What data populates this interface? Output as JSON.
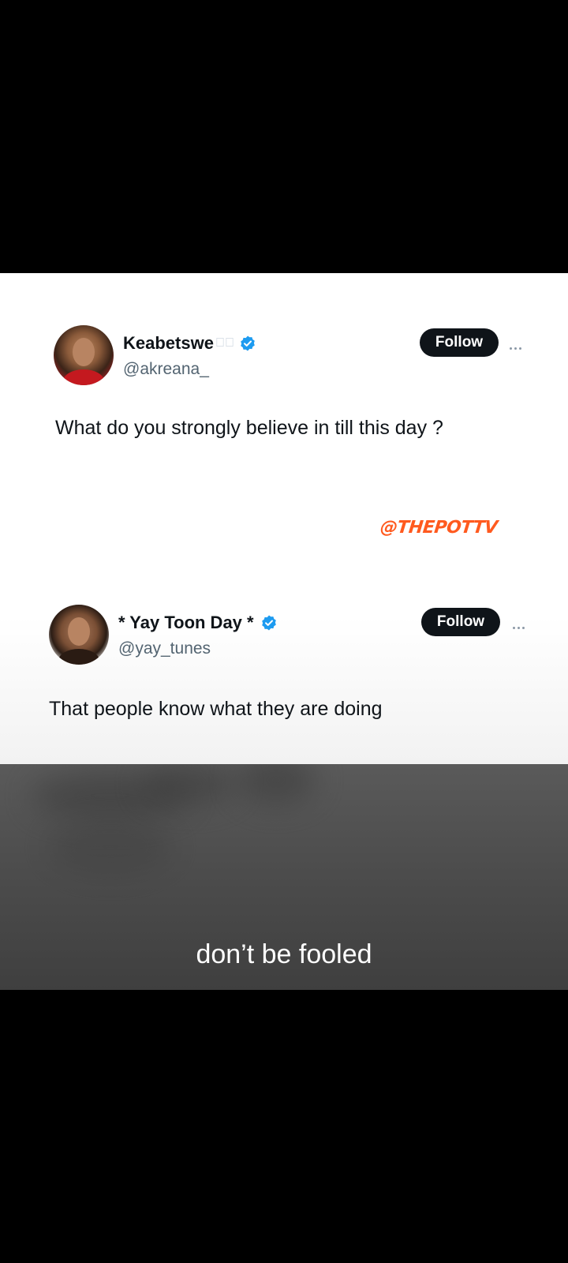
{
  "tweets": [
    {
      "display_name": "Keabetswe",
      "name_suffix": "ℐ⃣",
      "handle": "@akreana_",
      "follow_label": "Follow",
      "text": "What do you strongly believe in till this day ?",
      "verified": true
    },
    {
      "display_name": "* Yay Toon Day *",
      "handle": "@yay_tunes",
      "follow_label": "Follow",
      "text": "That people know what they are doing",
      "verified": true
    }
  ],
  "watermark": "@THEPOTTV",
  "caption": "don’t be fooled",
  "colors": {
    "verified_blue": "#1d9bf0",
    "follow_bg": "#0f1419",
    "watermark": "#ff5a1f"
  }
}
